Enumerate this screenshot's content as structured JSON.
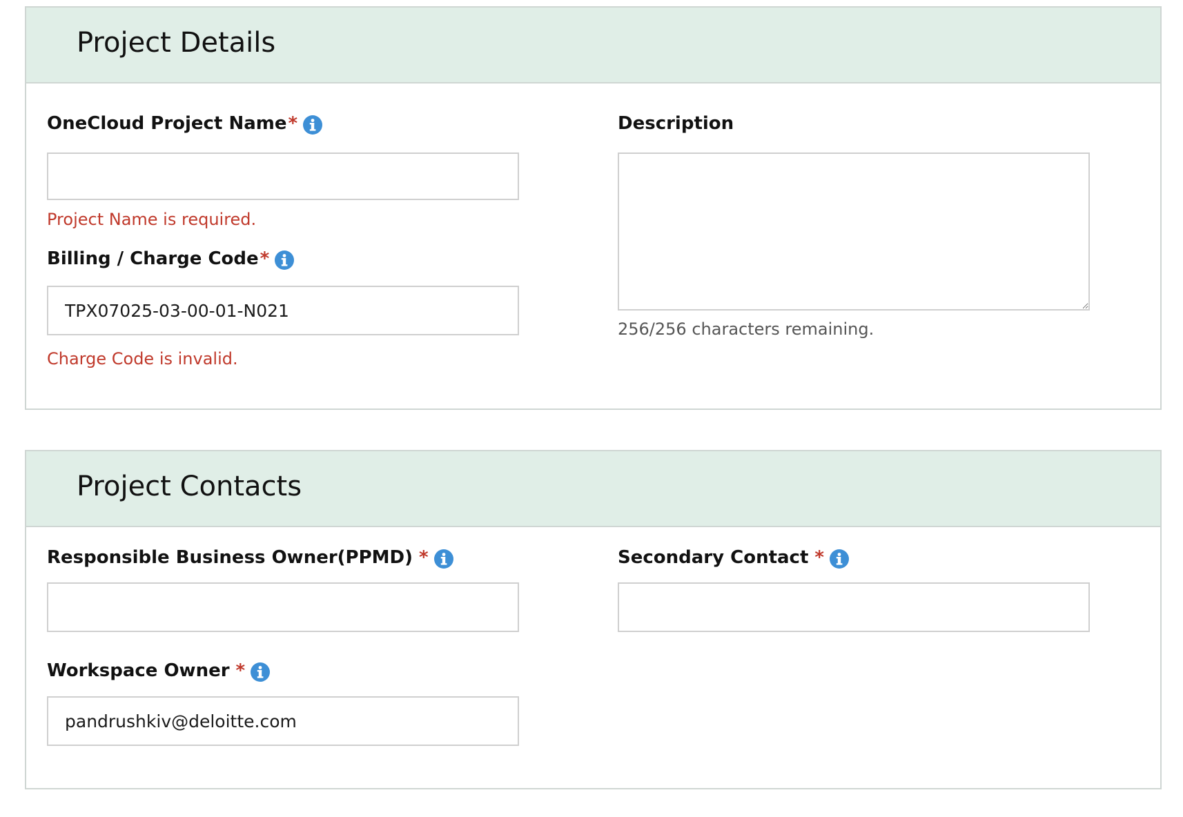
{
  "project_details": {
    "title": "Project Details",
    "project_name": {
      "label": "OneCloud Project Name",
      "required_mark": "*",
      "value": "",
      "error": "Project Name is required."
    },
    "charge_code": {
      "label": "Billing / Charge Code",
      "required_mark": "*",
      "value": "TPX07025-03-00-01-N021",
      "error": "Charge Code is invalid."
    },
    "description": {
      "label": "Description",
      "value": "",
      "remaining": "256/256 characters remaining."
    }
  },
  "project_contacts": {
    "title": "Project Contacts",
    "business_owner": {
      "label": "Responsible Business Owner(PPMD)",
      "required_mark": "*",
      "value": ""
    },
    "secondary_contact": {
      "label": "Secondary Contact",
      "required_mark": "*",
      "value": ""
    },
    "workspace_owner": {
      "label": "Workspace Owner",
      "required_mark": "*",
      "value": "pandrushkiv@deloitte.com"
    }
  },
  "colors": {
    "header_bg": "#e0eee7",
    "error": "#c0392b",
    "info_icon": "#3d8fd6",
    "border": "#cfcfcf"
  },
  "icons": {
    "info": "info-circle-icon"
  }
}
